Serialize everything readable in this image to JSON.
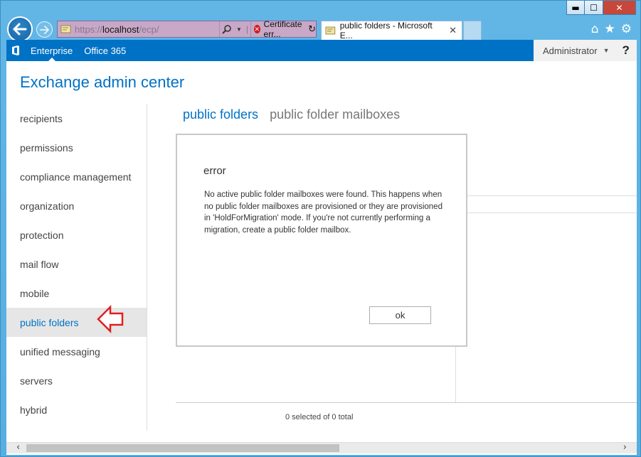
{
  "browser": {
    "address": {
      "protocol": "https://",
      "host": "localhost",
      "path": "/ecp/"
    },
    "certificate_error": "Certificate err...",
    "tab_title": "public folders - Microsoft E...",
    "window_buttons": {
      "minimize": "▬",
      "maximize": "☐",
      "close": "✕"
    },
    "tab_close": "✕",
    "right_icons": [
      "⌂",
      "★",
      "⚙"
    ]
  },
  "topbar": {
    "items": [
      "Enterprise",
      "Office 365"
    ],
    "active_index": 0,
    "user": "Administrator",
    "user_caret": "▼",
    "help": "?",
    "help_caret": "▼"
  },
  "app_title": "Exchange admin center",
  "nav": {
    "items": [
      "recipients",
      "permissions",
      "compliance management",
      "organization",
      "protection",
      "mail flow",
      "mobile",
      "public folders",
      "unified messaging",
      "servers",
      "hybrid"
    ],
    "selected": "public folders"
  },
  "subtabs": {
    "active": "public folders",
    "other": "public folder mailboxes"
  },
  "dialog": {
    "title": "error",
    "message": "No active public folder mailboxes were found. This happens when no public folder mailboxes are provisioned or they are provisioned in 'HoldForMigration' mode. If you're not currently performing a migration, create a public folder mailbox.",
    "ok": "ok"
  },
  "status": "0 selected of 0 total",
  "colors": {
    "accent": "#0072c6",
    "annotation_arrow": "#e02020"
  }
}
